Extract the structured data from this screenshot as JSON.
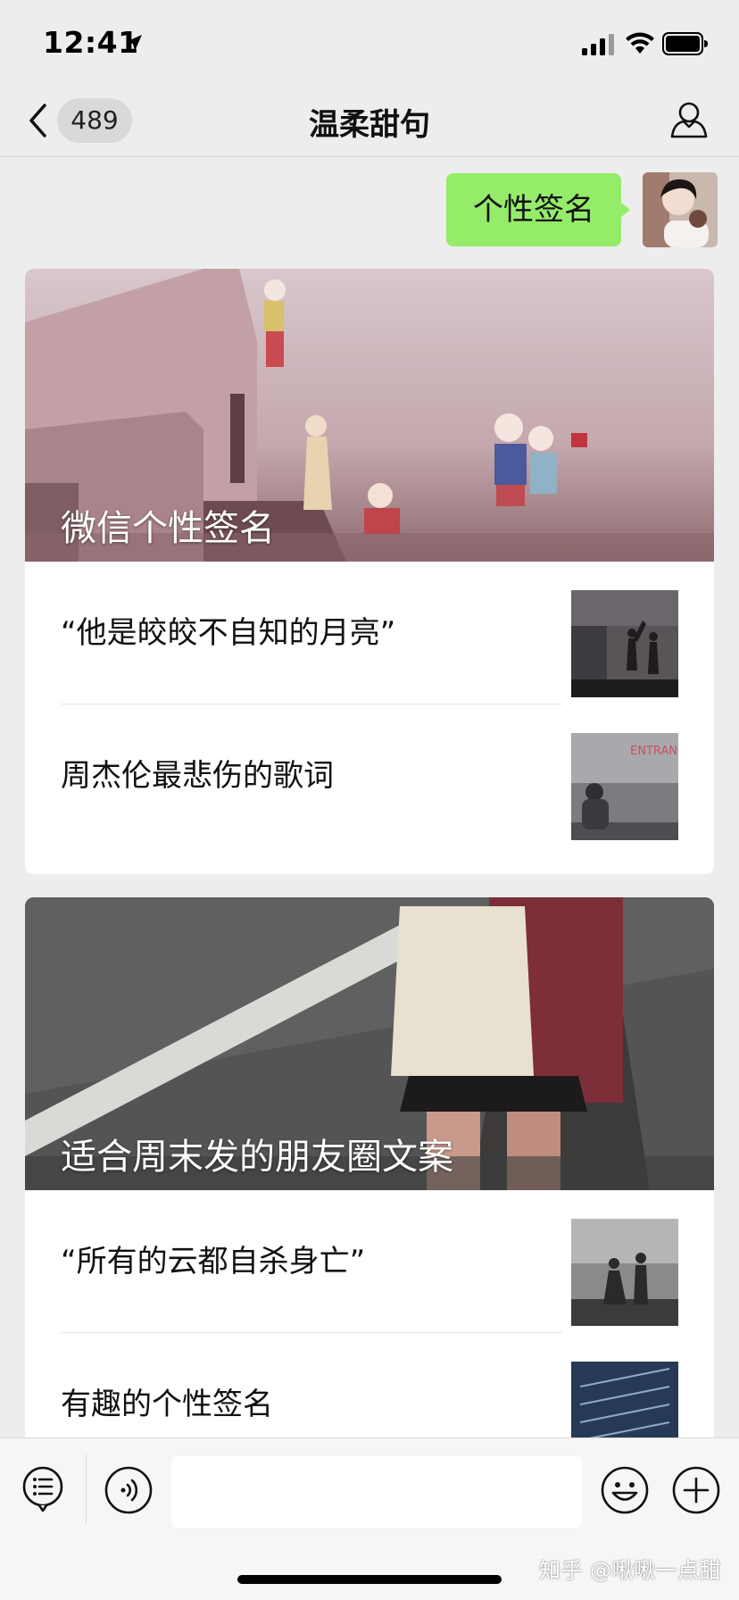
{
  "status_bar": {
    "time": "12:41"
  },
  "nav": {
    "unread_count": "489",
    "title": "温柔甜句"
  },
  "message": {
    "text": "个性签名"
  },
  "articles": [
    {
      "cover_title": "微信个性签名",
      "items": [
        {
          "title": "“他是皎皎不自知的月亮”"
        },
        {
          "title": "周杰伦最悲伤的歌词",
          "thumb_text": "ENTRAN"
        }
      ]
    },
    {
      "cover_title": "适合周末发的朋友圈文案",
      "items": [
        {
          "title": "“所有的云都自杀身亡”"
        },
        {
          "title": "有趣的个性签名"
        }
      ]
    }
  ],
  "input": {
    "placeholder": ""
  },
  "watermark": "知乎 @啾啾一点甜",
  "colors": {
    "bubble": "#95ec69",
    "background": "#ededed"
  }
}
